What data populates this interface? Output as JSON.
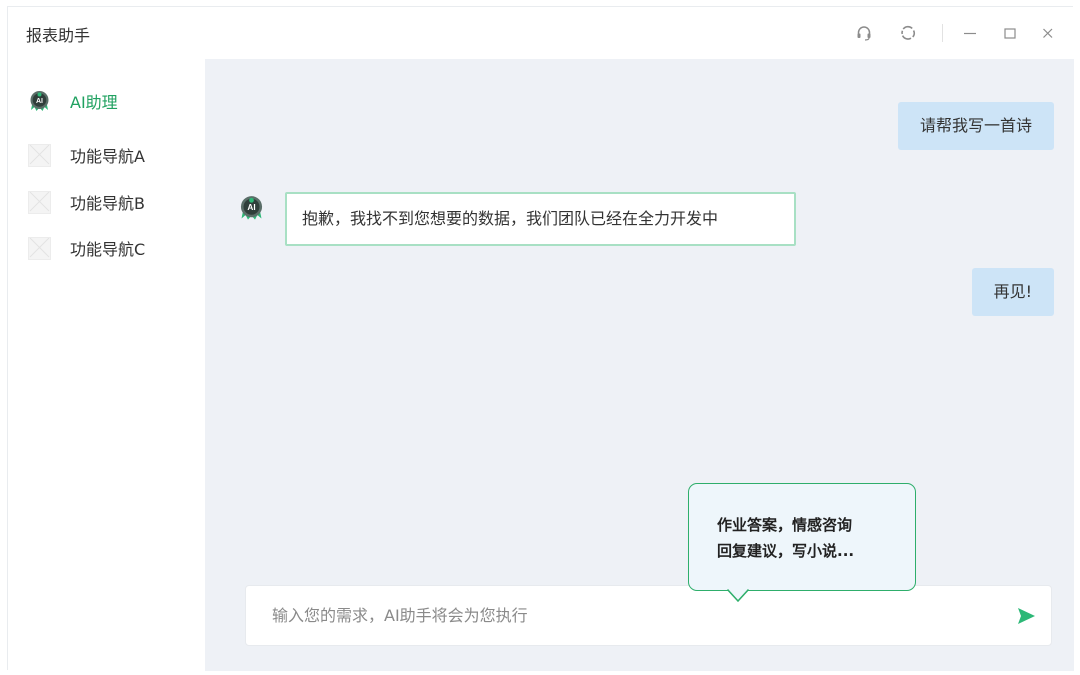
{
  "window": {
    "title": "报表助手",
    "controls": [
      "headset-icon",
      "refresh-icon",
      "minimize-icon",
      "maximize-icon",
      "close-icon"
    ]
  },
  "sidebar": {
    "items": [
      {
        "label": "AI助理",
        "icon": "ai-robot-icon",
        "active": true
      },
      {
        "label": "功能导航A",
        "icon": "image-placeholder-icon",
        "active": false
      },
      {
        "label": "功能导航B",
        "icon": "image-placeholder-icon",
        "active": false
      },
      {
        "label": "功能导航C",
        "icon": "image-placeholder-icon",
        "active": false
      }
    ]
  },
  "chat": {
    "messages": [
      {
        "role": "user",
        "text": "请帮我写一首诗"
      },
      {
        "role": "ai",
        "text": "抱歉，我找不到您想要的数据，我们团队已经在全力开发中"
      },
      {
        "role": "user",
        "text": "再见!"
      }
    ]
  },
  "composer": {
    "placeholder": "输入您的需求，AI助手将会为您执行",
    "value": "",
    "send_icon": "send-icon"
  },
  "tooltip": {
    "line1": "作业答案，情感咨询",
    "line2": "回复建议，写小说..."
  },
  "colors": {
    "accent": "#20a160",
    "user_bubble": "#cde4f7",
    "ai_bubble_border": "#a8e0c4",
    "chat_bg": "#eef1f6"
  }
}
